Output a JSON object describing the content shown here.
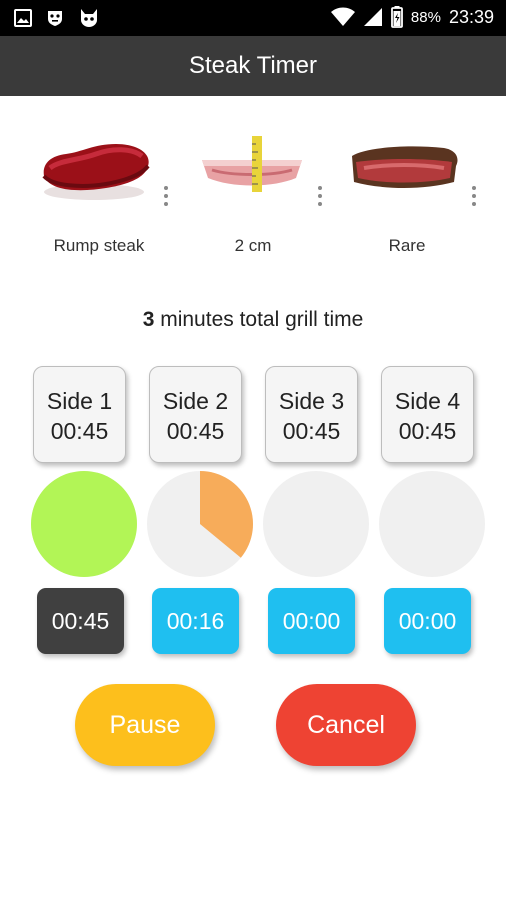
{
  "status_bar": {
    "battery_percent": "88%",
    "time": "23:39",
    "icons": [
      "image-icon",
      "shield-face-icon",
      "cat-icon",
      "wifi-icon",
      "signal-icon",
      "battery-icon"
    ]
  },
  "app_bar": {
    "title": "Steak Timer"
  },
  "choices": [
    {
      "label": "Rump steak",
      "icon": "raw-steak-image"
    },
    {
      "label": "2 cm",
      "icon": "steak-thickness-image"
    },
    {
      "label": "Rare",
      "icon": "rare-steak-image"
    }
  ],
  "total": {
    "minutes": "3",
    "suffix": "minutes total grill time"
  },
  "sides": [
    {
      "name": "Side 1",
      "time": "00:45"
    },
    {
      "name": "Side 2",
      "time": "00:45"
    },
    {
      "name": "Side 3",
      "time": "00:45"
    },
    {
      "name": "Side 4",
      "time": "00:45"
    }
  ],
  "progress": [
    {
      "fraction": 1.0,
      "color": "#b2f556"
    },
    {
      "fraction": 0.36,
      "color": "#f7ac5a"
    },
    {
      "fraction": 0,
      "color": "#f0f0f0"
    },
    {
      "fraction": 0,
      "color": "#f0f0f0"
    }
  ],
  "countdowns": [
    {
      "value": "00:45",
      "color": "#404040"
    },
    {
      "value": "00:16",
      "color": "#1fbff0"
    },
    {
      "value": "00:00",
      "color": "#1fbff0"
    },
    {
      "value": "00:00",
      "color": "#1fbff0"
    }
  ],
  "actions": {
    "pause_label": "Pause",
    "pause_color": "#fdbf1c",
    "cancel_label": "Cancel",
    "cancel_color": "#ee4333"
  }
}
